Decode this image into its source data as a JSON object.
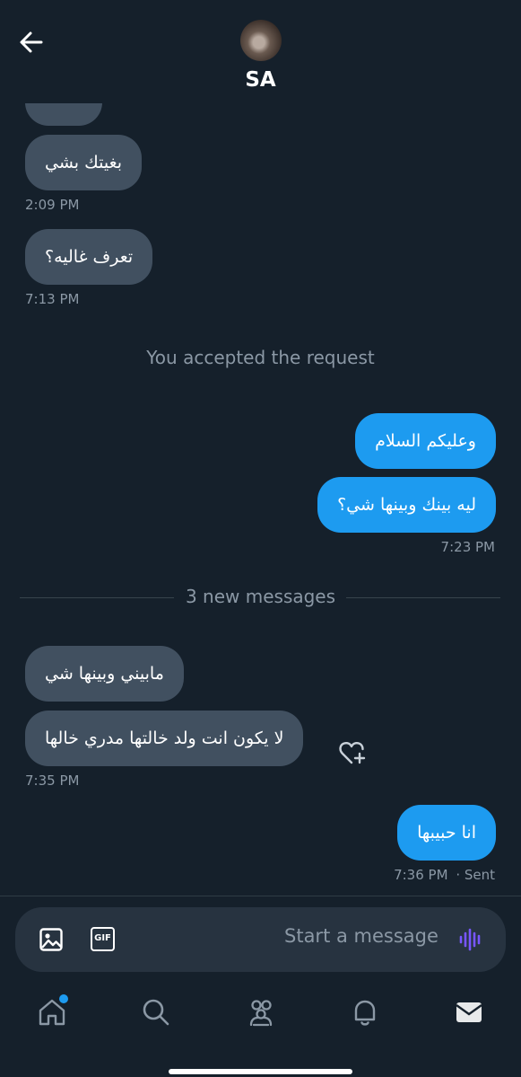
{
  "header": {
    "title": "SA"
  },
  "messages": {
    "m1_text": "بغيتك بشي",
    "m1_time": "2:09 PM",
    "m2_text": "تعرف غاليه؟",
    "m2_time": "7:13 PM",
    "system_note": "You accepted the request",
    "m3_text": "وعليكم السلام",
    "m4_text": "ليه بينك وبينها شي؟",
    "m4_time": "7:23 PM",
    "new_messages": "3 new messages",
    "m5_text": "مابيني وبينها شي",
    "m6_text": "لا يكون انت ولد خالتها مدري خالها",
    "m6_time": "7:35 PM",
    "m7_text": "انا حبيبها",
    "m7_time": "7:36 PM",
    "m7_status": "· Sent"
  },
  "composer": {
    "placeholder": "Start a message",
    "gif_label": "GIF"
  },
  "nav": {
    "items": [
      "home-icon",
      "search-icon",
      "communities-icon",
      "notifications-icon",
      "messages-icon"
    ]
  },
  "colors": {
    "background": "#15202b",
    "incoming": "#415060",
    "outgoing": "#1d9bf0",
    "muted": "#8b98a5",
    "accent_voice": "#7856ff"
  }
}
